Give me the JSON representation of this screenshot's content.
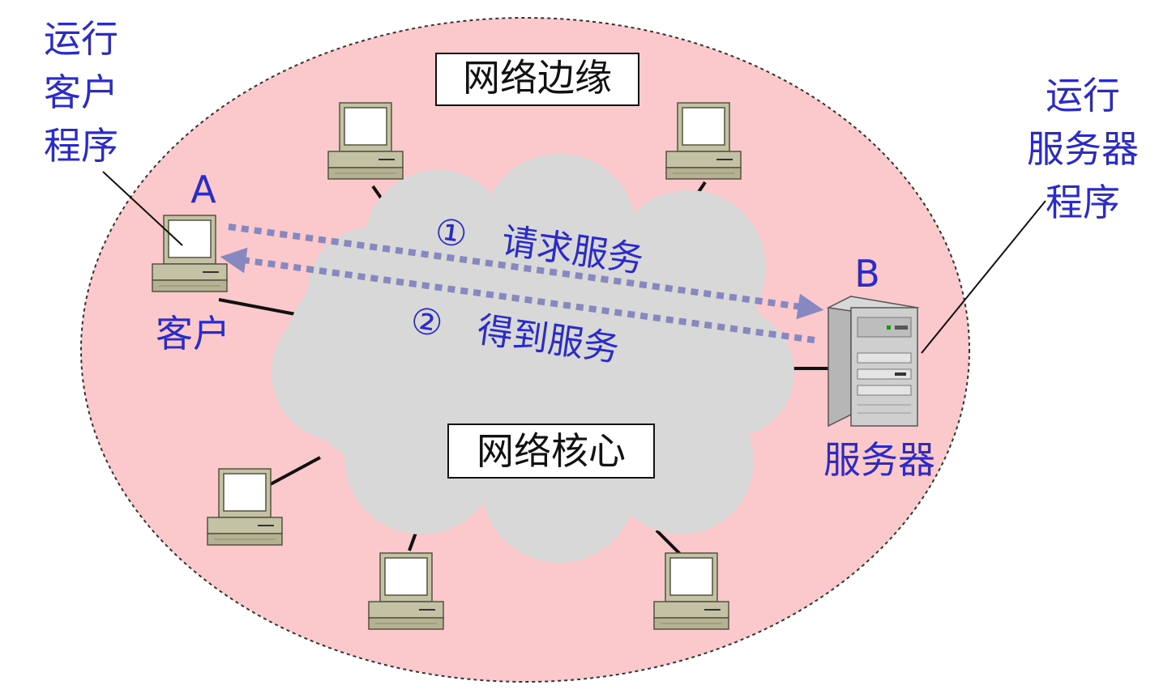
{
  "edge_label": "网络边缘",
  "core_label": "网络核心",
  "client_program": {
    "line1": "运行",
    "line2": "客户",
    "line3": "程序"
  },
  "server_program": {
    "line1": "运行",
    "line2": "服务器",
    "line3": "程序"
  },
  "host_a": {
    "letter": "A",
    "caption": "客户"
  },
  "host_b": {
    "letter": "B",
    "caption": "服务器"
  },
  "step1": {
    "number": "①",
    "text": "请求服务"
  },
  "step2": {
    "number": "②",
    "text": "得到服务"
  },
  "colors": {
    "edge_fill": "#fbc9cc",
    "cloud_fill": "#d8d8d8",
    "label_blue": "#2b2bc8",
    "arrow": "#8888c0",
    "computer_body": "#c4c2a4"
  }
}
